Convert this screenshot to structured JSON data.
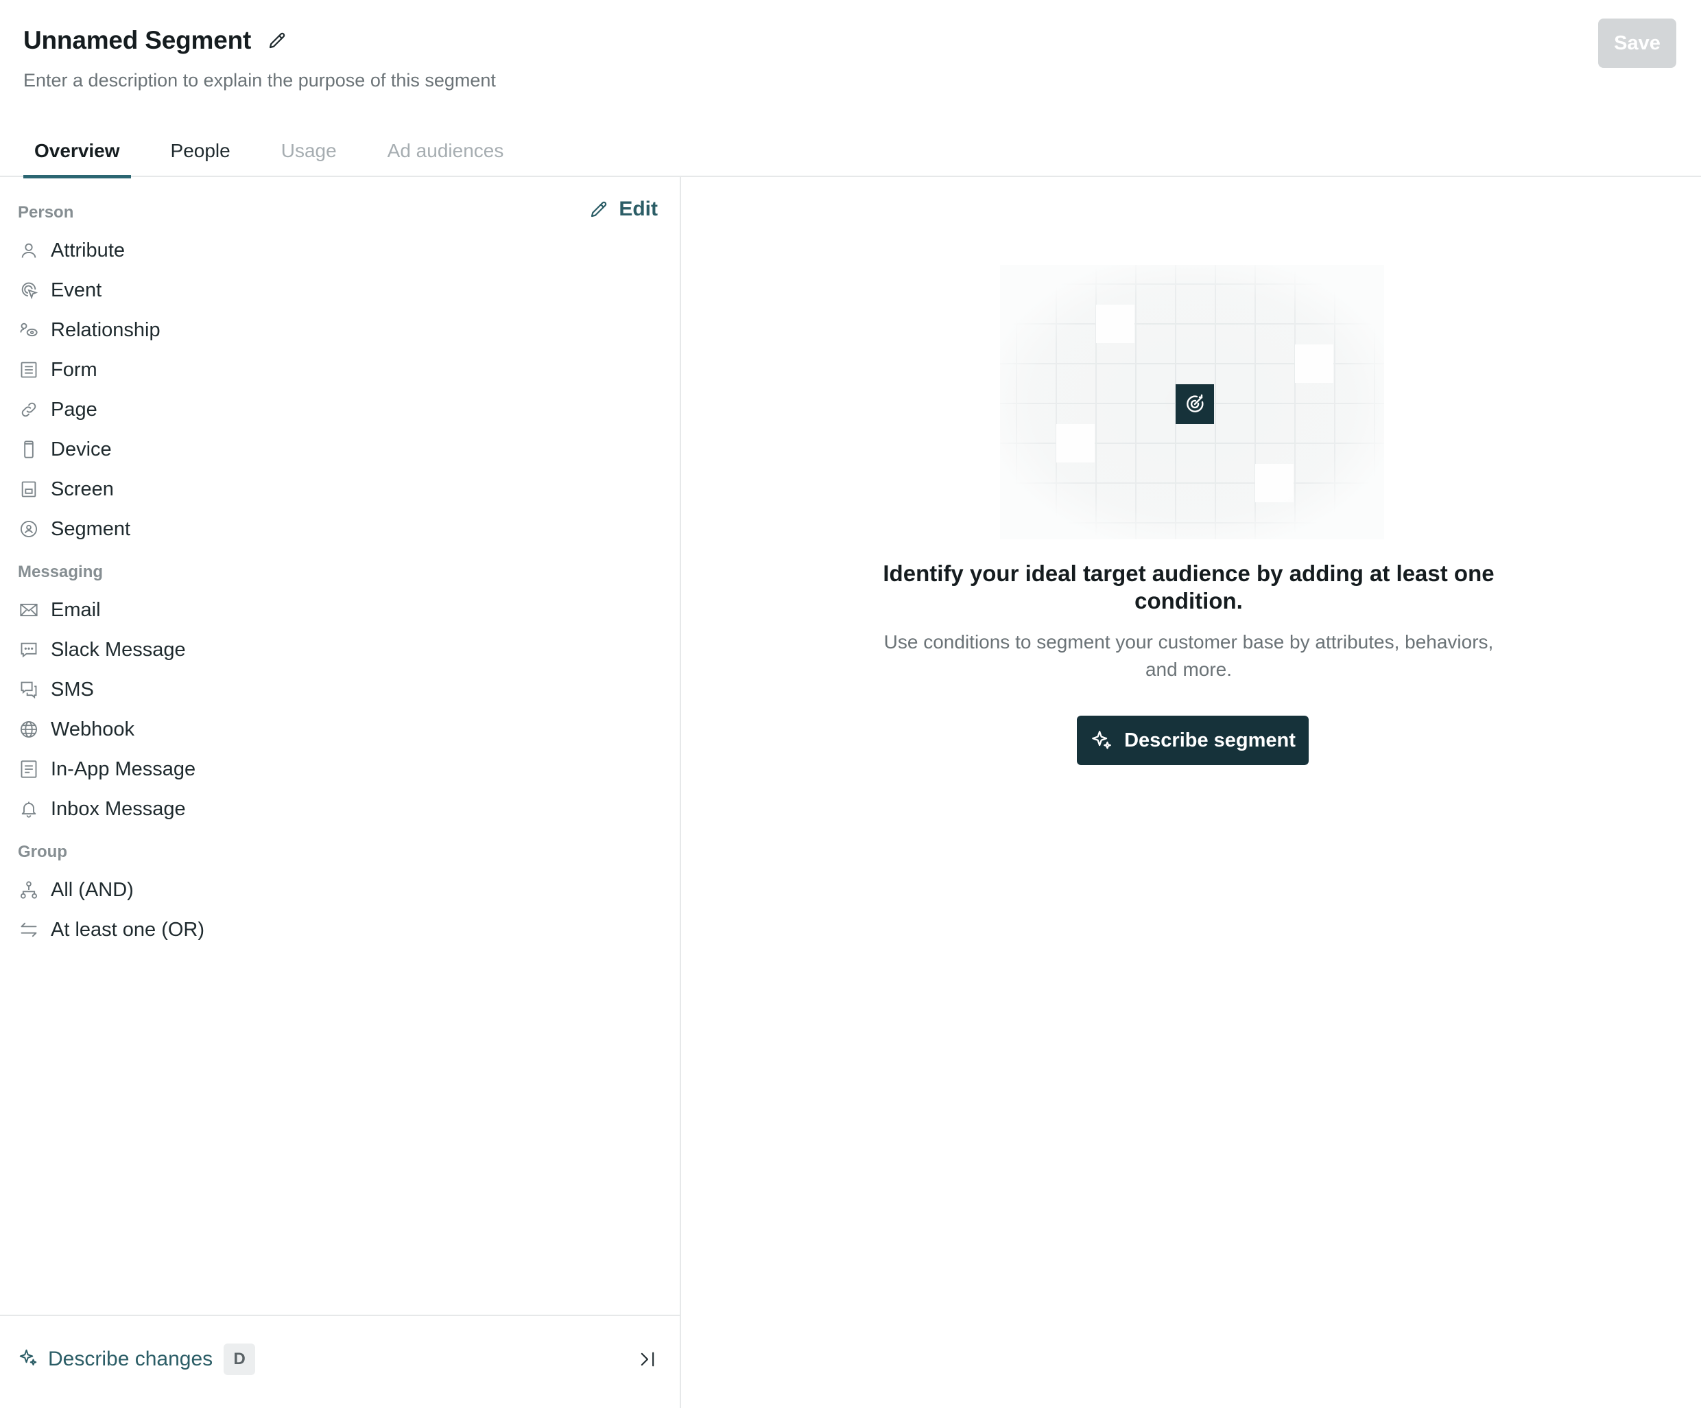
{
  "header": {
    "title": "Unnamed Segment",
    "description_placeholder": "Enter a description to explain the purpose of this segment",
    "save_label": "Save"
  },
  "tabs": [
    {
      "label": "Overview",
      "state": "active"
    },
    {
      "label": "People",
      "state": "enabled"
    },
    {
      "label": "Usage",
      "state": "disabled"
    },
    {
      "label": "Ad audiences",
      "state": "disabled"
    }
  ],
  "sidebar": {
    "edit_label": "Edit",
    "sections": [
      {
        "label": "Person",
        "items": [
          {
            "label": "Attribute",
            "icon": "person-icon"
          },
          {
            "label": "Event",
            "icon": "cursor-click-icon"
          },
          {
            "label": "Relationship",
            "icon": "relationship-icon"
          },
          {
            "label": "Form",
            "icon": "form-icon"
          },
          {
            "label": "Page",
            "icon": "link-icon"
          },
          {
            "label": "Device",
            "icon": "phone-icon"
          },
          {
            "label": "Screen",
            "icon": "screen-icon"
          },
          {
            "label": "Segment",
            "icon": "segment-icon"
          }
        ]
      },
      {
        "label": "Messaging",
        "items": [
          {
            "label": "Email",
            "icon": "envelope-icon"
          },
          {
            "label": "Slack Message",
            "icon": "chat-bubble-icon"
          },
          {
            "label": "SMS",
            "icon": "sms-icon"
          },
          {
            "label": "Webhook",
            "icon": "globe-icon"
          },
          {
            "label": "In-App Message",
            "icon": "in-app-icon"
          },
          {
            "label": "Inbox Message",
            "icon": "bell-icon"
          }
        ]
      },
      {
        "label": "Group",
        "items": [
          {
            "label": "All (AND)",
            "icon": "branch-icon"
          },
          {
            "label": "At least one (OR)",
            "icon": "arrows-swap-icon"
          }
        ]
      }
    ],
    "footer": {
      "describe_changes_label": "Describe changes",
      "shortcut": "D"
    }
  },
  "empty_state": {
    "heading": "Identify your ideal target audience by adding at least one condition.",
    "subtext": "Use conditions to segment your customer base by attributes, behaviors, and more.",
    "button_label": "Describe segment",
    "illustration_icon": "target-icon"
  },
  "colors": {
    "accent_teal": "#2b6672",
    "primary_button": "#16323a",
    "save_disabled": "#d3d6d8"
  }
}
